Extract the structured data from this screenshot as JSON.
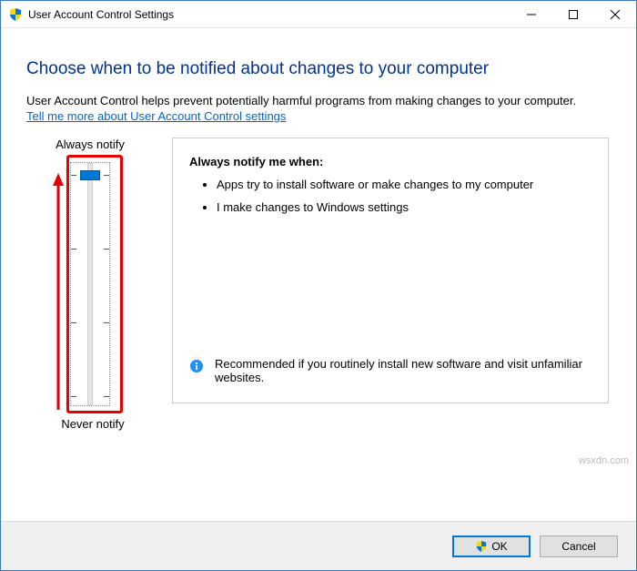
{
  "titlebar": {
    "title": "User Account Control Settings"
  },
  "content": {
    "heading": "Choose when to be notified about changes to your computer",
    "description": "User Account Control helps prevent potentially harmful programs from making changes to your computer.",
    "link_text": "Tell me more about User Account Control settings"
  },
  "slider": {
    "label_top": "Always notify",
    "label_bottom": "Never notify",
    "steps": 4,
    "current_step": 0
  },
  "info_panel": {
    "title": "Always notify me when:",
    "items": [
      "Apps try to install software or make changes to my computer",
      "I make changes to Windows settings"
    ],
    "recommend": "Recommended if you routinely install new software and visit unfamiliar websites."
  },
  "buttons": {
    "ok": "OK",
    "cancel": "Cancel"
  },
  "watermark": "wsxdn.com"
}
